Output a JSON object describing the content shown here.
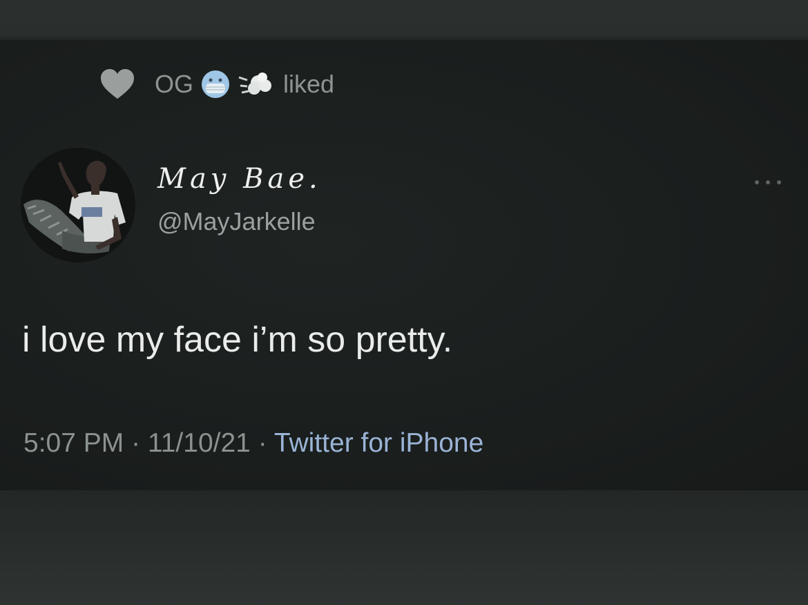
{
  "liked_by": {
    "heart_icon": "heart-icon",
    "user_name": "OG",
    "emojis": [
      "cold-face-mask-emoji",
      "dashing-away-emoji"
    ],
    "action_text": "liked"
  },
  "author": {
    "display_name": "May Bae.",
    "handle": "@MayJarkelle",
    "avatar_icon": "profile-photo"
  },
  "tweet": {
    "text": "i love my face i’m so pretty."
  },
  "meta": {
    "time": "5:07 PM",
    "separator": "·",
    "date": "11/10/21",
    "source": "Twitter for iPhone"
  },
  "colors": {
    "background": "#1a1e1d",
    "text_primary": "#e9ecea",
    "text_secondary": "#8c9290",
    "link": "#9ab4d6"
  }
}
